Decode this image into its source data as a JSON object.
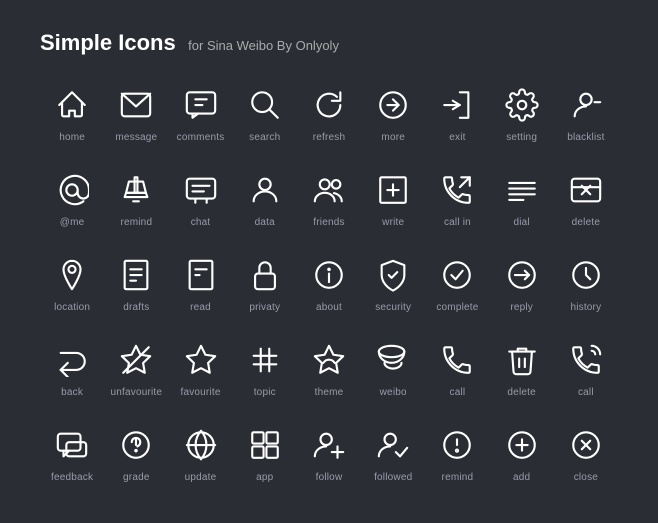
{
  "title": "Simple Icons",
  "subtitle": "for Sina Weibo By Onlyoly",
  "icons": [
    {
      "name": "home-icon",
      "label": "home",
      "interactable": false
    },
    {
      "name": "message-icon",
      "label": "message",
      "interactable": false
    },
    {
      "name": "comments-icon",
      "label": "comments",
      "interactable": false
    },
    {
      "name": "search-icon",
      "label": "search",
      "interactable": false
    },
    {
      "name": "refresh-icon",
      "label": "refresh",
      "interactable": false
    },
    {
      "name": "more-icon",
      "label": "more",
      "interactable": false
    },
    {
      "name": "exit-icon",
      "label": "exit",
      "interactable": false
    },
    {
      "name": "setting-icon",
      "label": "setting",
      "interactable": false
    },
    {
      "name": "blacklist-icon",
      "label": "blacklist",
      "interactable": false
    },
    {
      "name": "atme-icon",
      "label": "@me",
      "interactable": false
    },
    {
      "name": "remind-icon",
      "label": "remind",
      "interactable": false
    },
    {
      "name": "chat-icon",
      "label": "chat",
      "interactable": false
    },
    {
      "name": "data-icon",
      "label": "data",
      "interactable": false
    },
    {
      "name": "friends-icon",
      "label": "friends",
      "interactable": false
    },
    {
      "name": "write-icon",
      "label": "write",
      "interactable": false
    },
    {
      "name": "callin-icon",
      "label": "call in",
      "interactable": false
    },
    {
      "name": "dial-icon",
      "label": "dial",
      "interactable": false
    },
    {
      "name": "delete-icon",
      "label": "delete",
      "interactable": false
    },
    {
      "name": "location-icon",
      "label": "location",
      "interactable": false
    },
    {
      "name": "drafts-icon",
      "label": "drafts",
      "interactable": false
    },
    {
      "name": "read-icon",
      "label": "read",
      "interactable": false
    },
    {
      "name": "privacy-icon",
      "label": "privaty",
      "interactable": false
    },
    {
      "name": "about-icon",
      "label": "about",
      "interactable": false
    },
    {
      "name": "security-icon",
      "label": "security",
      "interactable": false
    },
    {
      "name": "complete-icon",
      "label": "complete",
      "interactable": false
    },
    {
      "name": "reply-icon",
      "label": "reply",
      "interactable": false
    },
    {
      "name": "history-icon",
      "label": "history",
      "interactable": false
    },
    {
      "name": "back-icon",
      "label": "back",
      "interactable": false
    },
    {
      "name": "unfavourite-icon",
      "label": "unfavourite",
      "interactable": false
    },
    {
      "name": "favourite-icon",
      "label": "favourite",
      "interactable": false
    },
    {
      "name": "topic-icon",
      "label": "topic",
      "interactable": false
    },
    {
      "name": "theme-icon",
      "label": "theme",
      "interactable": false
    },
    {
      "name": "weibo-icon",
      "label": "weibo",
      "interactable": false
    },
    {
      "name": "call-icon",
      "label": "call",
      "interactable": false
    },
    {
      "name": "delete2-icon",
      "label": "delete",
      "interactable": false
    },
    {
      "name": "call2-icon",
      "label": "call",
      "interactable": false
    },
    {
      "name": "feedback-icon",
      "label": "feedback",
      "interactable": false
    },
    {
      "name": "grade-icon",
      "label": "grade",
      "interactable": false
    },
    {
      "name": "update-icon",
      "label": "update",
      "interactable": false
    },
    {
      "name": "app-icon",
      "label": "app",
      "interactable": false
    },
    {
      "name": "follow-icon",
      "label": "follow",
      "interactable": false
    },
    {
      "name": "followed-icon",
      "label": "followed",
      "interactable": false
    },
    {
      "name": "remind2-icon",
      "label": "remind",
      "interactable": false
    },
    {
      "name": "add-icon",
      "label": "add",
      "interactable": false
    },
    {
      "name": "close-icon",
      "label": "close",
      "interactable": false
    }
  ]
}
